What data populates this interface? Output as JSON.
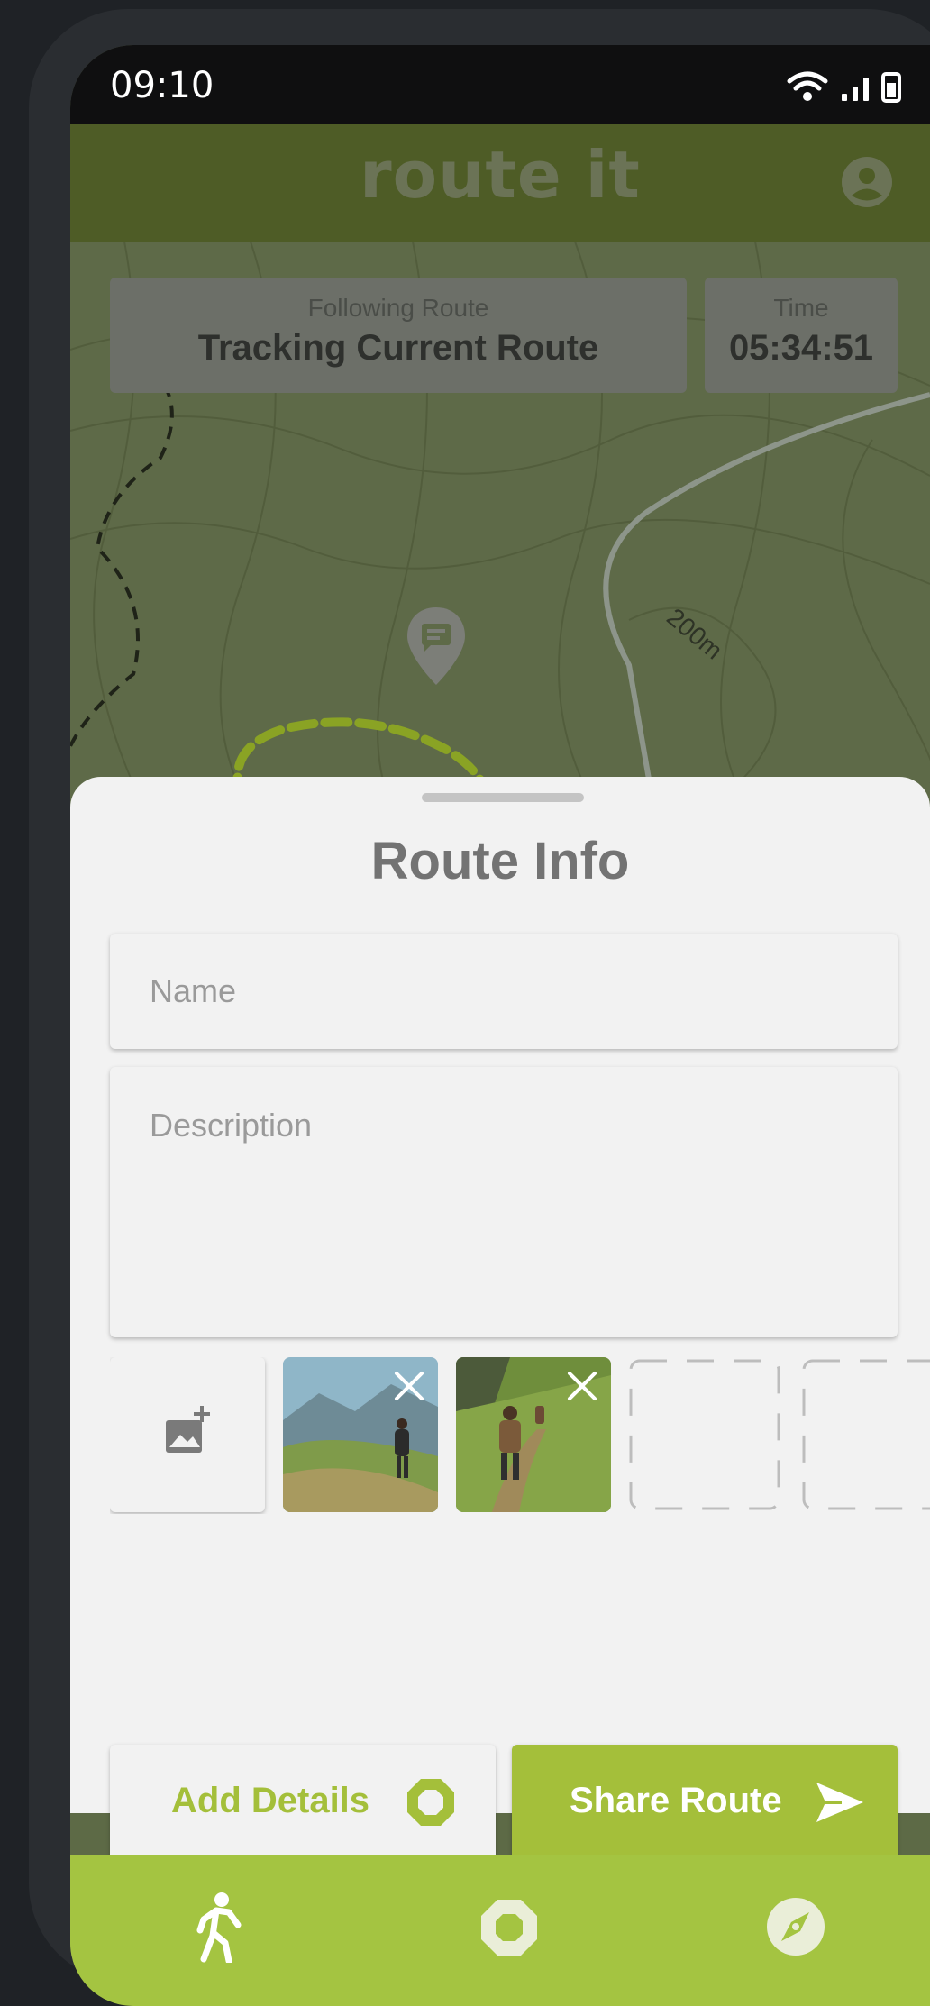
{
  "status_bar": {
    "time": "09:10"
  },
  "app_bar": {
    "title": "route it",
    "profile_icon": "account-circle-icon"
  },
  "map": {
    "following_label": "Following Route",
    "following_value": "Tracking Current Route",
    "time_label": "Time",
    "time_value": "05:34:51",
    "contour_label": "200m",
    "marker_icon": "comment-pin-icon"
  },
  "sheet": {
    "title": "Route Info",
    "name_placeholder": "Name",
    "description_placeholder": "Description",
    "add_photo_icon": "add-photo-icon",
    "photos": [
      "hiker-on-mountain-path",
      "hikers-on-grassy-trail"
    ],
    "empty_slots": 2,
    "add_details_label": "Add Details",
    "share_route_label": "Share Route"
  },
  "bottom_nav": {
    "items": [
      {
        "icon": "walking-icon"
      },
      {
        "icon": "octagon-record-icon"
      },
      {
        "icon": "compass-icon"
      }
    ]
  },
  "colors": {
    "accent": "#a4c441",
    "app_bar": "#4e5c26",
    "sheet_bg": "#f2f2f2"
  }
}
